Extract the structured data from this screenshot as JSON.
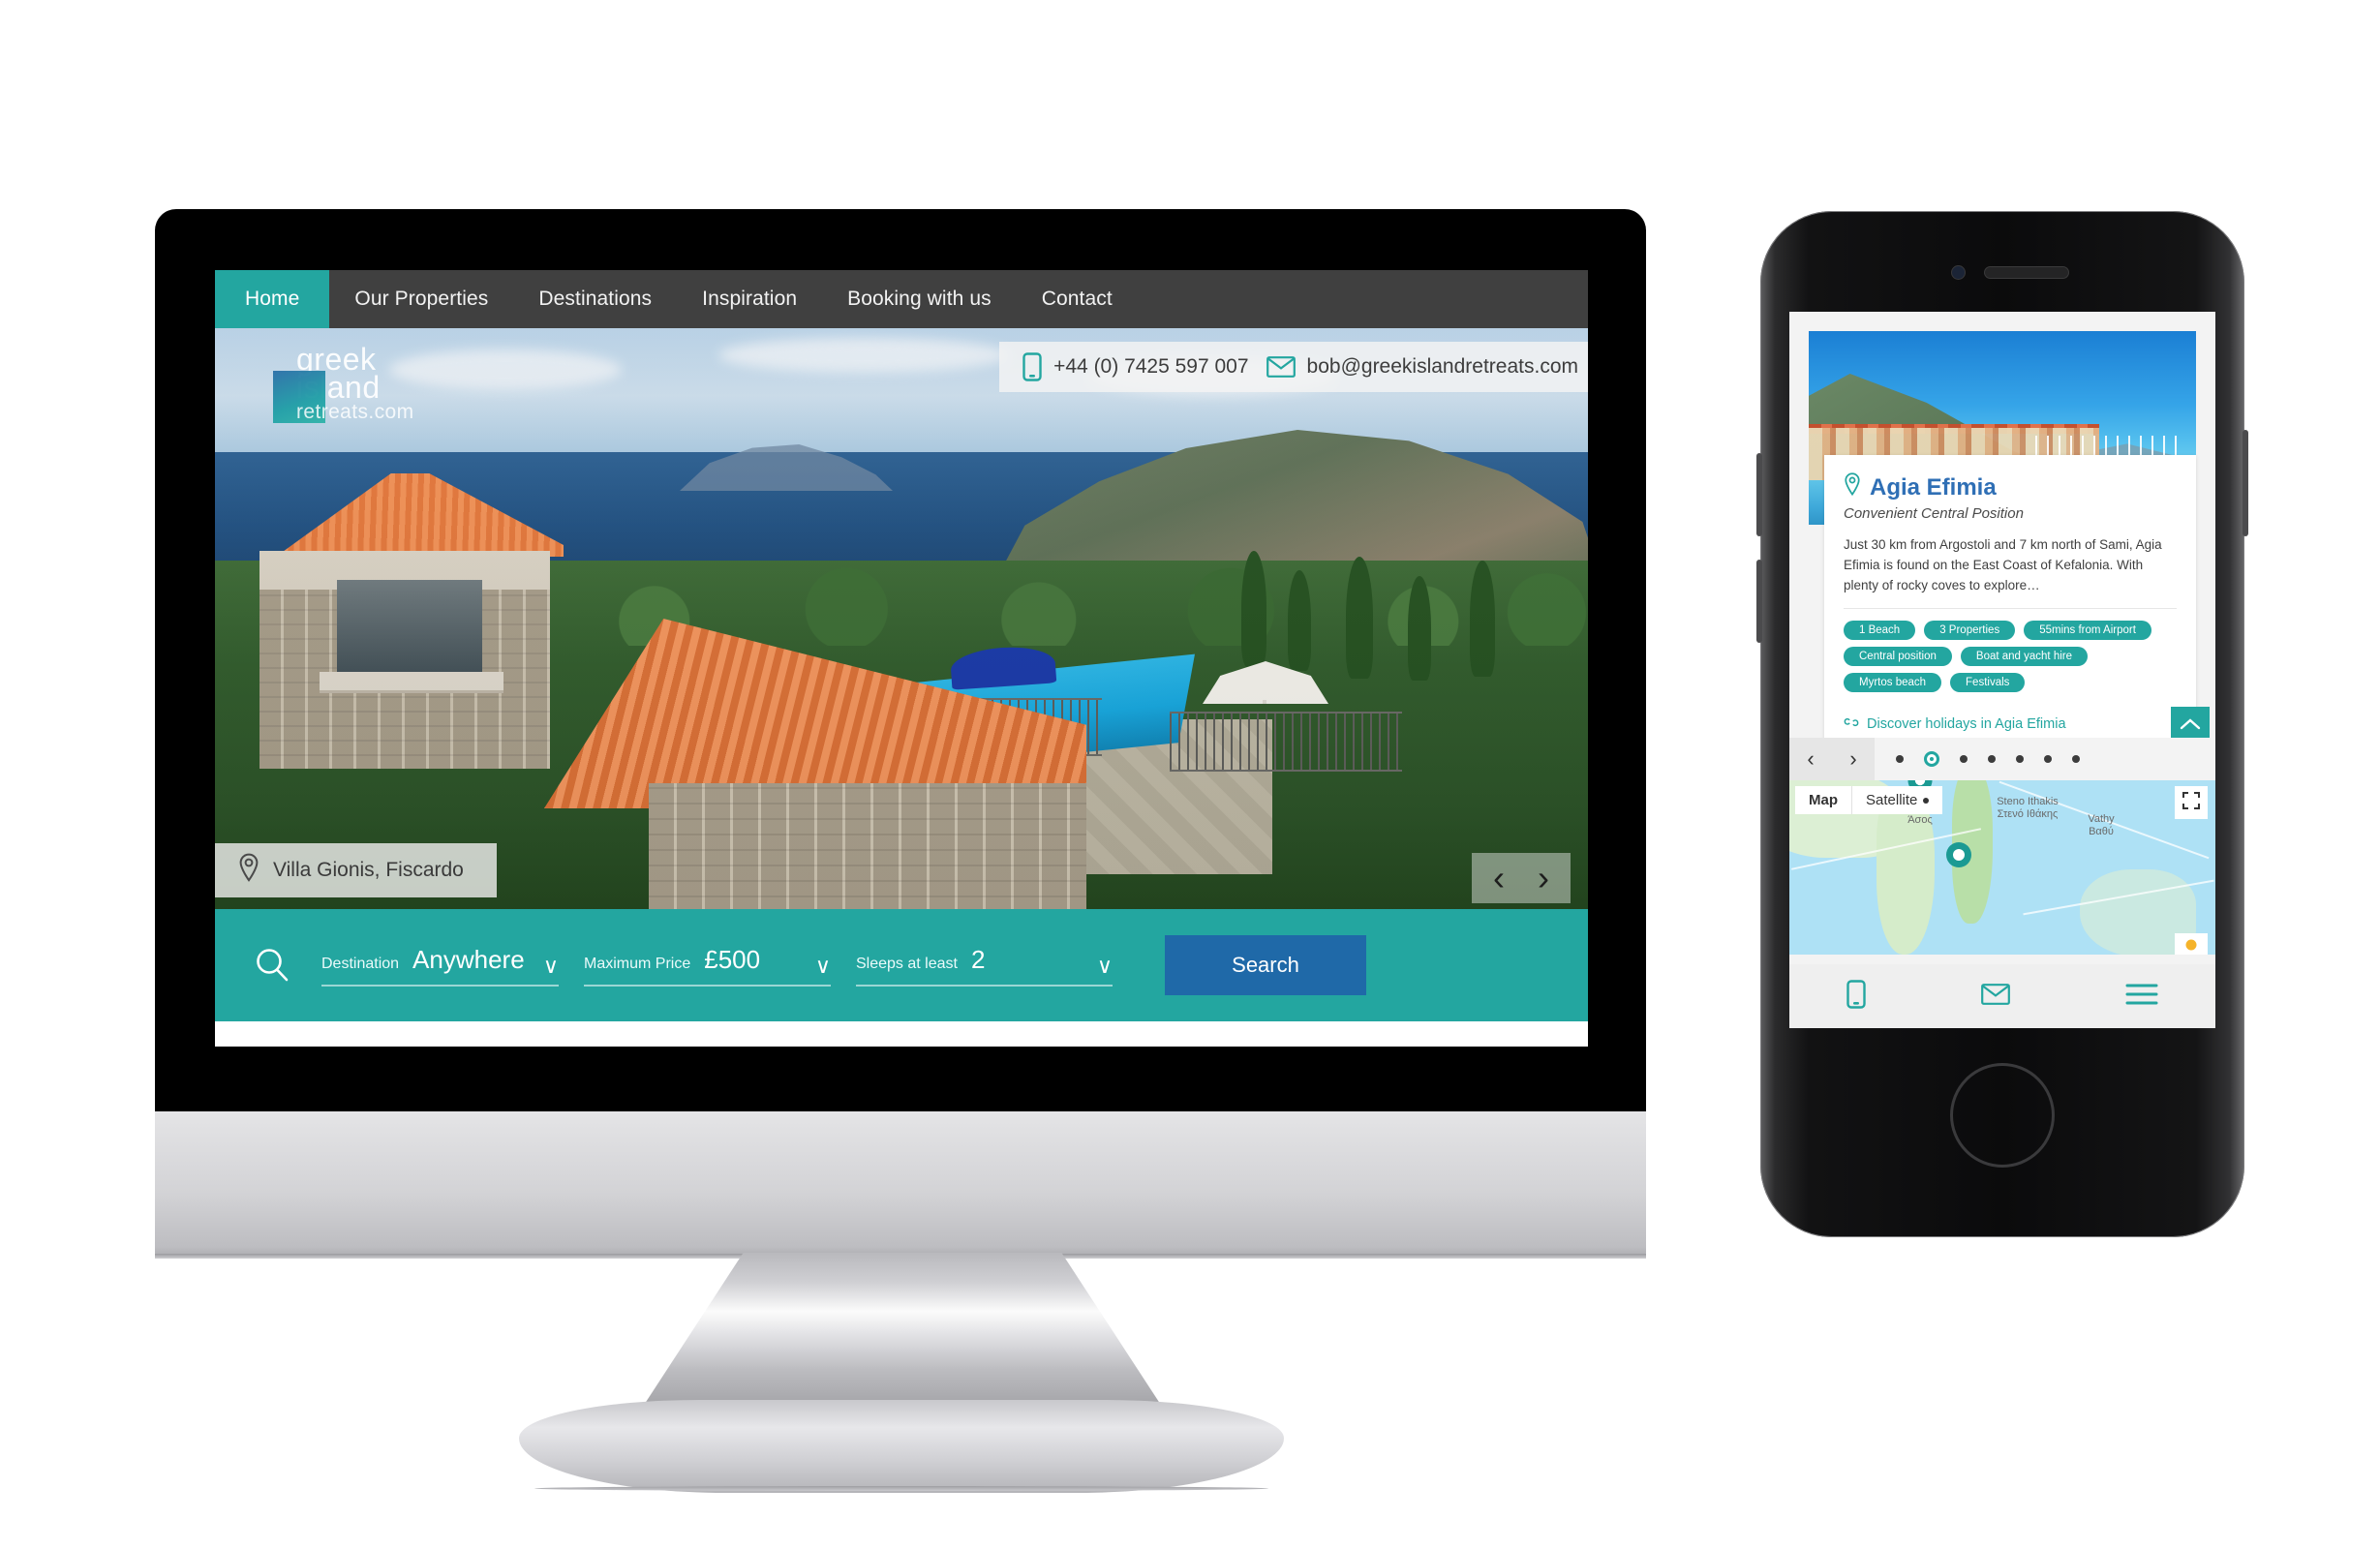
{
  "desktop": {
    "nav": [
      {
        "label": "Home",
        "active": true
      },
      {
        "label": "Our Properties",
        "active": false
      },
      {
        "label": "Destinations",
        "active": false
      },
      {
        "label": "Inspiration",
        "active": false
      },
      {
        "label": "Booking with us",
        "active": false
      },
      {
        "label": "Contact",
        "active": false
      }
    ],
    "logo": {
      "line1": "greek",
      "line2": "island",
      "line3": "retreats.com"
    },
    "contact": {
      "phone": "+44 (0) 7425 597 007",
      "email": "bob@greekislandretreats.com",
      "phone_icon": "mobile-icon",
      "email_icon": "envelope-icon"
    },
    "hero": {
      "caption": "Villa Gionis, Fiscardo",
      "caption_icon": "map-pin-icon",
      "prev_arrow": "‹",
      "next_arrow": "›"
    },
    "search": {
      "icon": "search-icon",
      "fields": [
        {
          "label": "Destination",
          "value": "Anywhere"
        },
        {
          "label": "Maximum Price",
          "value": "£500"
        },
        {
          "label": "Sleeps at least",
          "value": "2"
        }
      ],
      "chevron": "∨",
      "button_label": "Search"
    }
  },
  "phone": {
    "card": {
      "pin_icon": "map-pin-icon",
      "title": "Agia Efimia",
      "subtitle": "Convenient Central Position",
      "body": "Just 30 km from Argostoli and 7 km north of Sami, Agia Efimia is found on the East Coast of Kefalonia. With plenty of rocky coves to explore…",
      "tags": [
        "1 Beach",
        "3 Properties",
        "55mins from Airport",
        "Central position",
        "Boat and yacht hire",
        "Myrtos beach",
        "Festivals"
      ],
      "link_icon": "link-icon",
      "link_label": "Discover holidays in Agia Efimia"
    },
    "scroll_top_icon": "chevron-up-icon",
    "pager": {
      "prev": "‹",
      "next": "›",
      "dot_count": 7,
      "active_dot": 2
    },
    "map": {
      "button_map": "Map",
      "button_satellite": "Satellite",
      "fullscreen_icon": "fullscreen-icon",
      "labels": [
        {
          "name": "Assos",
          "greek": "Άσος"
        },
        {
          "name": "Steno Ithakis",
          "greek": "Στενό Ιθάκης"
        },
        {
          "name": "Vathy",
          "greek": "Βαθύ"
        }
      ]
    },
    "bottomnav": [
      {
        "icon": "mobile-icon",
        "name": "phone-nav-button"
      },
      {
        "icon": "envelope-icon",
        "name": "email-nav-button"
      },
      {
        "icon": "hamburger-icon",
        "name": "menu-nav-button"
      }
    ]
  },
  "colors": {
    "teal": "#23a6a0",
    "dark_nav": "#404040",
    "blue_button": "#1f69a8",
    "card_title_blue": "#2f6fb5"
  }
}
